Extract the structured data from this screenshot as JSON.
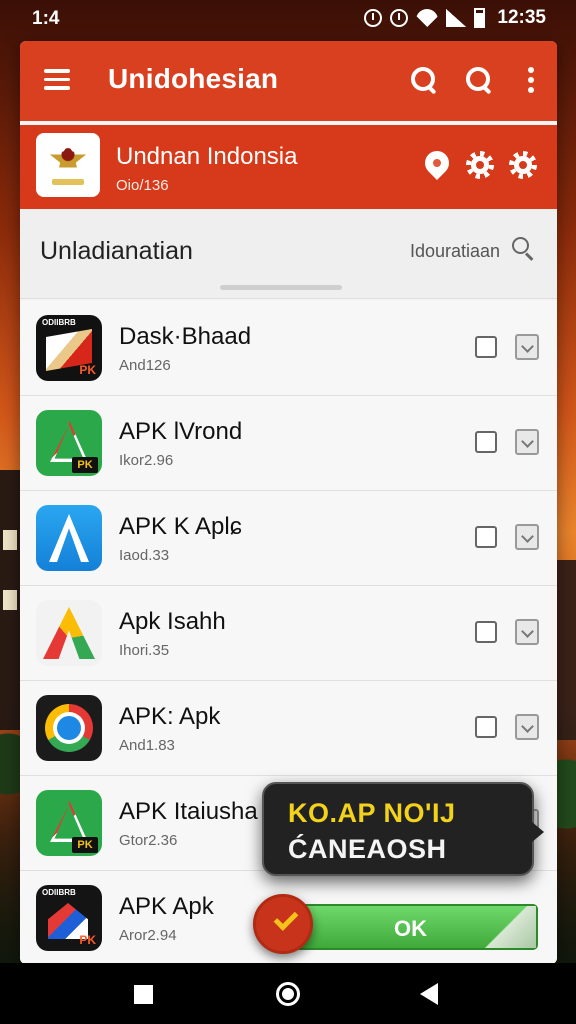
{
  "status_bar": {
    "time_left": "1:4",
    "time_right": "12:35"
  },
  "toolbar": {
    "title": "Unidohesian"
  },
  "sub_header": {
    "title": "Undnan Indonsia",
    "code": "Oio/136"
  },
  "section": {
    "title": "Unladianatian",
    "search_label": "Idouratiaan"
  },
  "apps": [
    {
      "name": "Dask·Bhaad",
      "sub": "And126",
      "icon": "book-icon"
    },
    {
      "name": "APK lVrond",
      "sub": "Ikor2.96",
      "icon": "green-triangle-icon"
    },
    {
      "name": "APK K Aplɕ",
      "sub": "Iaod.33",
      "icon": "blue-triangle-icon"
    },
    {
      "name": "Apk Isahh",
      "sub": "Ihori.35",
      "icon": "multicolor-triangle-icon"
    },
    {
      "name": "APK: Apk",
      "sub": "And1.83",
      "icon": "chrome-icon"
    },
    {
      "name": "APK Itaiusha",
      "sub": "Gtor2.36",
      "icon": "green-triangle-icon"
    },
    {
      "name": "APK Apk",
      "sub": "Aror2.94",
      "icon": "house-icon"
    }
  ],
  "icon_text": {
    "book_top": "ODIIBRB",
    "pk": "PK"
  },
  "toast": {
    "line1": "KO.AP NO'IJ",
    "line2": "ĆANEAOSH"
  },
  "ok_button": {
    "label": "OK"
  },
  "colors": {
    "toolbar": "#d9401f",
    "sub_header": "#d63a1a",
    "ok_green": "#4fbf4a",
    "toast_yellow": "#f2d21a"
  }
}
